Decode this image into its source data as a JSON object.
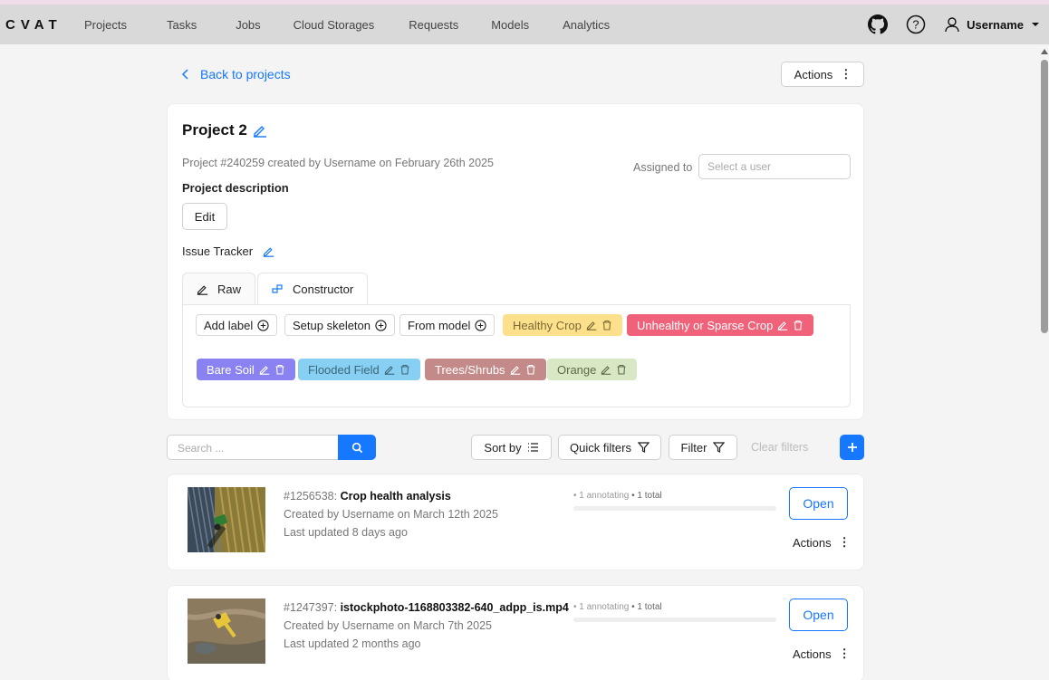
{
  "app": {
    "logo": "CVAT",
    "user": "Username"
  },
  "nav": {
    "items": [
      "Projects",
      "Tasks",
      "Jobs",
      "Cloud Storages",
      "Requests",
      "Models",
      "Analytics"
    ]
  },
  "back_label": "Back to projects",
  "top_actions_label": "Actions",
  "project": {
    "title": "Project 2",
    "meta": "Project #240259 created by Username on February 26th 2025",
    "assigned_label": "Assigned to",
    "assigned_placeholder": "Select a user",
    "description_label": "Project description",
    "edit_label": "Edit",
    "issue_tracker_label": "Issue Tracker",
    "tabs": [
      "Raw",
      "Constructor"
    ],
    "label_buttons": [
      "Add label",
      "Setup skeleton",
      "From model"
    ],
    "labels": [
      {
        "name": "Healthy Crop",
        "color": "#fde08c",
        "text_color": "#7a6a33"
      },
      {
        "name": "Unhealthy or Sparse Crop",
        "color": "#f0627a",
        "text_color": "#ffffff"
      },
      {
        "name": "Bare Soil",
        "color": "#8a82f0",
        "text_color": "#ffffff"
      },
      {
        "name": "Flooded Field",
        "color": "#87d0f4",
        "text_color": "#3e6679"
      },
      {
        "name": "Trees/Shrubs",
        "color": "#c48a8a",
        "text_color": "#ffffff"
      },
      {
        "name": "Orange",
        "color": "#d9e8c4",
        "text_color": "#5b6a4b"
      }
    ]
  },
  "toolbar": {
    "search_placeholder": "Search ...",
    "sort_label": "Sort by",
    "quick_filters_label": "Quick filters",
    "filter_label": "Filter",
    "clear_label": "Clear filters"
  },
  "tasks": [
    {
      "id": "#1256538:",
      "name": "Crop health analysis",
      "created": "Created by Username on March 12th 2025",
      "updated": "Last updated 8 days ago",
      "progress_annotating": "• 1 annotating",
      "progress_total": "• 1 total",
      "progress": 0,
      "open_label": "Open",
      "actions_label": "Actions"
    },
    {
      "id": "#1247397:",
      "name": "istockphoto-1168803382-640_adpp_is.mp4",
      "created": "Created by Username on March 7th 2025",
      "updated": "Last updated 2 months ago",
      "progress_annotating": "• 1 annotating",
      "progress_total": "• 1 total",
      "progress": 0,
      "open_label": "Open",
      "actions_label": "Actions"
    }
  ]
}
